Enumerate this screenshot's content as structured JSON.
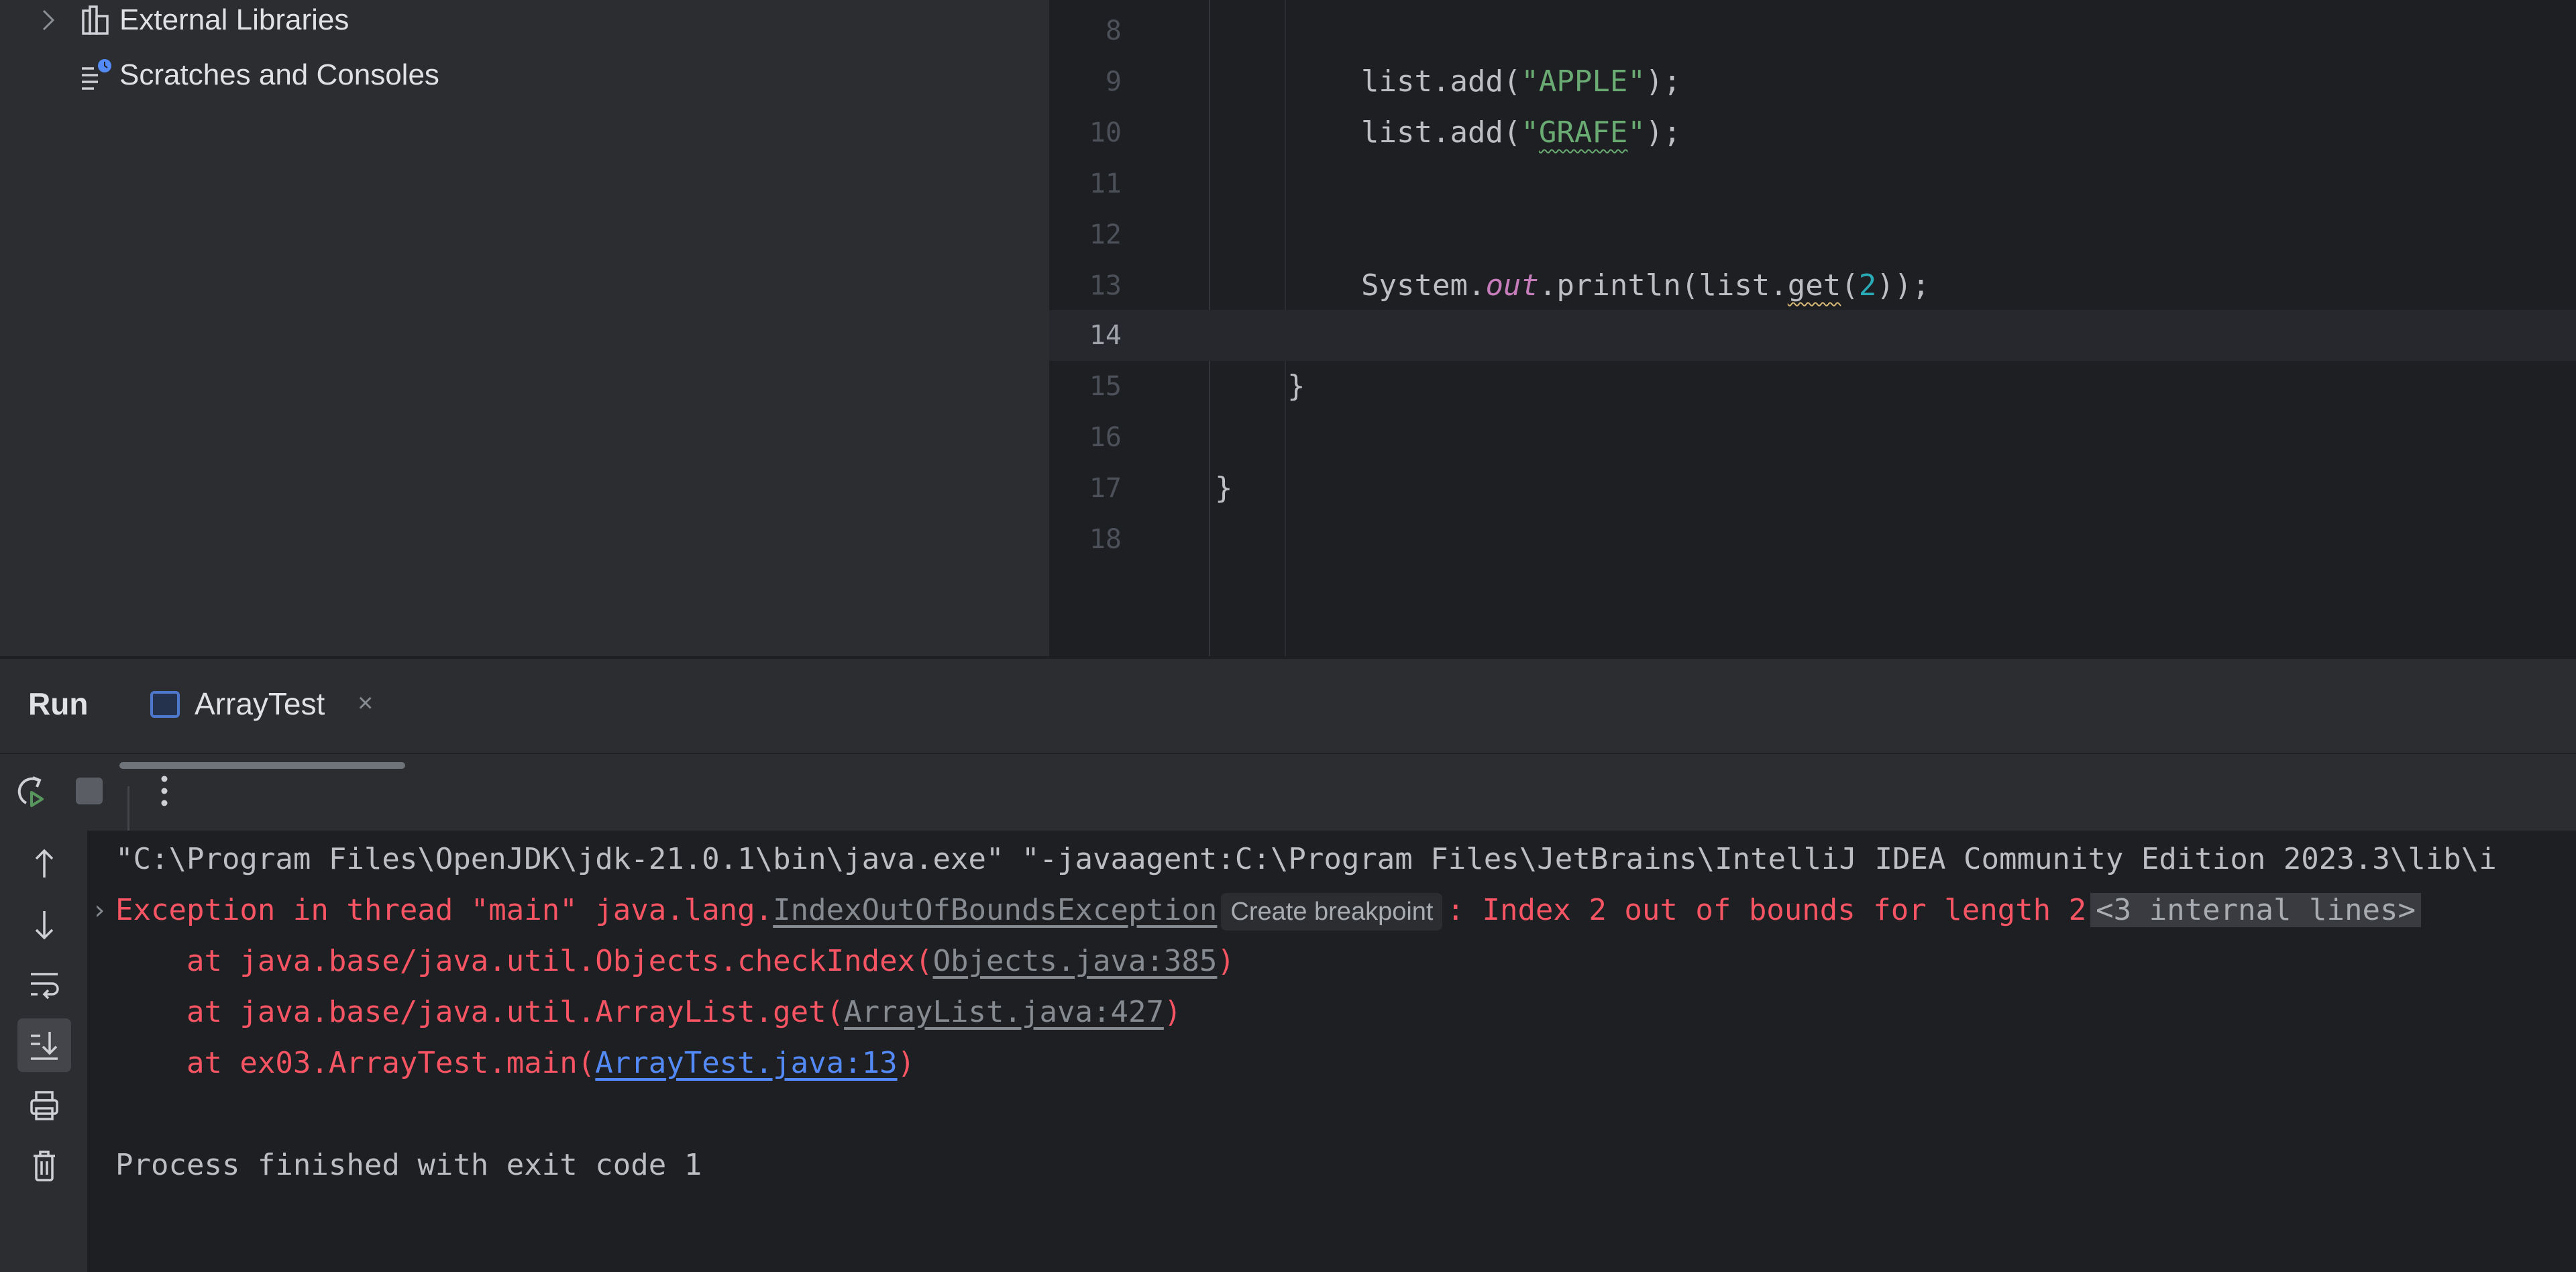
{
  "project_tree": {
    "items": [
      {
        "label": "External Libraries",
        "icon": "library-icon",
        "expandable": true
      },
      {
        "label": "Scratches and Consoles",
        "icon": "scratches-icon",
        "expandable": false
      }
    ]
  },
  "editor": {
    "current_line": 14,
    "lines": [
      {
        "number": "8"
      },
      {
        "number": "9",
        "parts": [
          "list.add(",
          "\"APPLE\"",
          ");"
        ]
      },
      {
        "number": "10",
        "parts": [
          "list.add(",
          "\"",
          "GRAFE",
          "\"",
          ");"
        ]
      },
      {
        "number": "11"
      },
      {
        "number": "12"
      },
      {
        "number": "13",
        "parts": [
          "System.",
          "out",
          ".println(list.",
          "get",
          "(",
          "2",
          "));"
        ]
      },
      {
        "number": "14"
      },
      {
        "number": "15",
        "parts": [
          "}"
        ]
      },
      {
        "number": "16"
      },
      {
        "number": "17",
        "parts": [
          "}"
        ]
      },
      {
        "number": "18"
      }
    ]
  },
  "run_window": {
    "title": "Run",
    "tab": {
      "label": "ArrayTest",
      "close": "×"
    },
    "toolbar": {
      "rerun": "rerun-icon",
      "stop": "stop-icon",
      "more": "more-options-icon"
    },
    "side_buttons": [
      {
        "icon": "arrow-up-icon",
        "label": "Up the stack trace"
      },
      {
        "icon": "arrow-down-icon",
        "label": "Down the stack trace"
      },
      {
        "icon": "soft-wrap-icon",
        "label": "Soft-wrap"
      },
      {
        "icon": "scroll-to-end-icon",
        "label": "Scroll to the end",
        "active": true
      },
      {
        "icon": "print-icon",
        "label": "Print"
      },
      {
        "icon": "trash-icon",
        "label": "Clear All"
      }
    ],
    "console": {
      "command": "\"C:\\Program Files\\OpenJDK\\jdk-21.0.1\\bin\\java.exe\" \"-javaagent:C:\\Program Files\\JetBrains\\IntelliJ IDEA Community Edition 2023.3\\lib\\i",
      "exception_prefix": "Exception in thread \"main\" java.lang.",
      "exception_class": "IndexOutOfBoundsException",
      "create_breakpoint": "Create breakpoint",
      "exception_message": ": Index 2 out of bounds for length 2",
      "internal_lines": "<3 internal lines>",
      "stack": [
        {
          "prefix": "    at java.base/java.util.Objects.checkIndex(",
          "link": "Objects.java:385",
          "suffix": ")",
          "link_style": "gray"
        },
        {
          "prefix": "    at java.base/java.util.ArrayList.get(",
          "link": "ArrayList.java:427",
          "suffix": ")",
          "link_style": "gray"
        },
        {
          "prefix": "    at ex03.ArrayTest.main(",
          "link": "ArrayTest.java:13",
          "suffix": ")",
          "link_style": "blue"
        }
      ],
      "exit_message": "Process finished with exit code 1"
    }
  },
  "colors": {
    "error": "#f75464",
    "link": "#548af7",
    "string": "#6aab73",
    "number": "#2aacb8",
    "field": "#c77dbb",
    "editor_bg": "#1e1f22",
    "panel_bg": "#2b2d30"
  }
}
